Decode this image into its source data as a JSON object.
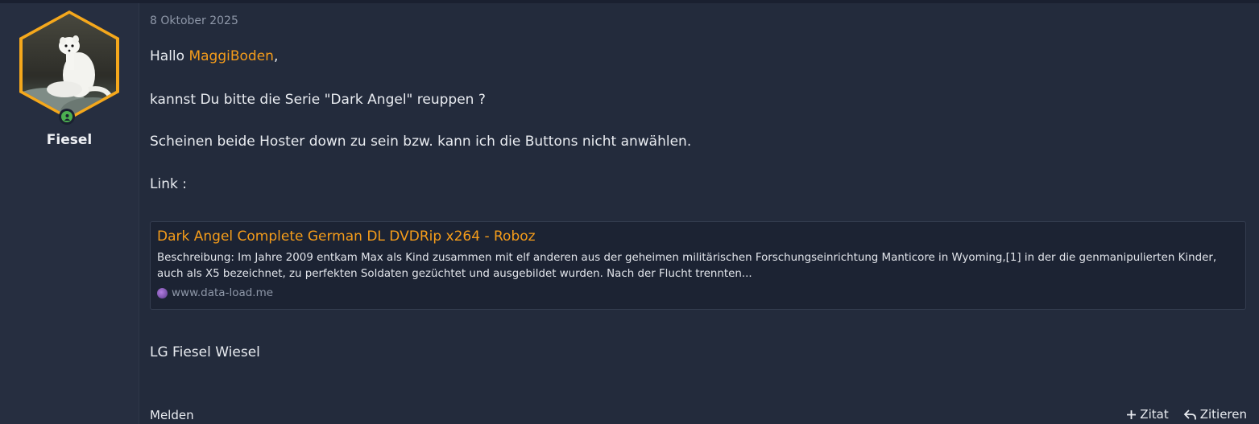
{
  "author": {
    "name": "Fiesel",
    "online": true
  },
  "post": {
    "date": "8 Oktober 2025",
    "greeting_prefix": "Hallo ",
    "mention": "MaggiBoden",
    "greeting_suffix": ",",
    "line2": "kannst Du bitte die Serie \"Dark Angel\" reuppen ?",
    "line3": "Scheinen beide Hoster down zu sein bzw. kann ich die Buttons nicht anwählen.",
    "line4": "Link :",
    "signoff": "LG Fiesel Wiesel"
  },
  "unfurl": {
    "title": "Dark Angel Complete German DL DVDRip x264 - Roboz",
    "description": "Beschreibung: Im Jahre 2009 entkam Max als Kind zusammen mit elf anderen aus der geheimen militärischen Forschungseinrichtung Manticore in Wyoming,[1] in der die genmanipulierten Kinder, auch als X5 bezeichnet, zu perfekten Soldaten gezüchtet und ausgebildet wurden. Nach der Flucht trennten...",
    "domain": "www.data-load.me"
  },
  "actions": {
    "report": "Melden",
    "quote_add": "Zitat",
    "reply": "Zitieren"
  },
  "colors": {
    "accent": "#f59c1a",
    "online": "#4caf50",
    "background": "#232b3c"
  },
  "icons": {
    "plus": "plus-icon",
    "reply": "reply-icon",
    "online": "user-online-icon"
  }
}
